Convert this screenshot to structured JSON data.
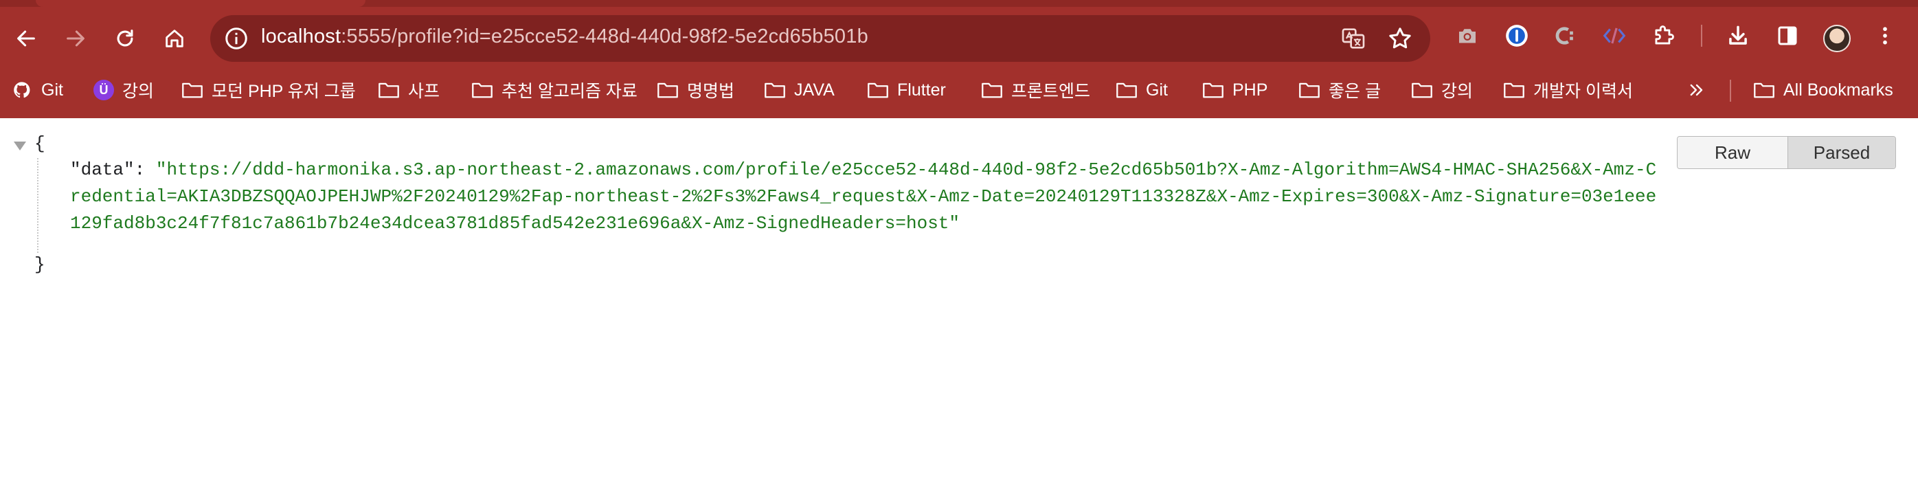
{
  "browser": {
    "url": {
      "host": "localhost",
      "rest": ":5555/profile?id=e25cce52-448d-440d-98f2-5e2cd65b501b"
    },
    "bookmarks": [
      {
        "label": "Git",
        "icon": "github-icon"
      },
      {
        "label": "강의",
        "icon": "inflearn-icon"
      },
      {
        "label": "모던 PHP 유저 그룹",
        "icon": "folder-icon"
      },
      {
        "label": "사프",
        "icon": "folder-icon"
      },
      {
        "label": "추천 알고리즘 자료",
        "icon": "folder-icon"
      },
      {
        "label": "명명법",
        "icon": "folder-icon"
      },
      {
        "label": "JAVA",
        "icon": "folder-icon"
      },
      {
        "label": "Flutter",
        "icon": "folder-icon"
      },
      {
        "label": "프론트엔드",
        "icon": "folder-icon"
      },
      {
        "label": "Git",
        "icon": "folder-icon"
      },
      {
        "label": "PHP",
        "icon": "folder-icon"
      },
      {
        "label": "좋은 글",
        "icon": "folder-icon"
      },
      {
        "label": "강의",
        "icon": "folder-icon"
      },
      {
        "label": "개발자 이력서",
        "icon": "folder-icon"
      }
    ],
    "all_bookmarks_label": "All Bookmarks",
    "colors": {
      "chrome": "#a2302c",
      "omnibox": "#7f2220",
      "json_string": "#1e7a1e"
    }
  },
  "json_viewer": {
    "open_brace": "{",
    "close_brace": "}",
    "key": "\"data\"",
    "colon": ": ",
    "value": "\"https://ddd-harmonika.s3.ap-northeast-2.amazonaws.com/profile/e25cce52-448d-440d-98f2-5e2cd65b501b?X-Amz-Algorithm=AWS4-HMAC-SHA256&X-Amz-Credential=AKIA3DBZSQQAOJPEHJWP%2F20240129%2Fap-northeast-2%2Fs3%2Faws4_request&X-Amz-Date=20240129T113328Z&X-Amz-Expires=300&X-Amz-Signature=03e1eee129fad8b3c24f7f81c7a861b7b24e34dcea3781d85fad542e231e696a&X-Amz-SignedHeaders=host\"",
    "toggle": {
      "raw_label": "Raw",
      "parsed_label": "Parsed",
      "selected": "Parsed"
    }
  }
}
